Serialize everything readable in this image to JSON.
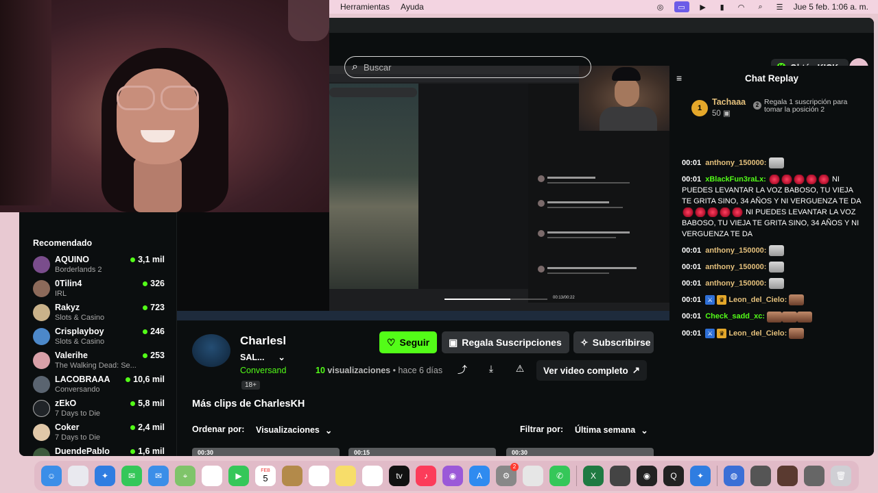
{
  "menubar": {
    "items": [
      "Herramientas",
      "Ayuda"
    ],
    "clock": "Jue 5 feb.  1:06 a. m."
  },
  "header": {
    "search_placeholder": "Buscar",
    "get_kicks": "Obtén KICKs"
  },
  "sidebar": {
    "title": "Recomendado",
    "channels": [
      {
        "name": "AQUINO",
        "category": "Borderlands 2",
        "viewers": "3,1 mil",
        "color": "#7a4d8c"
      },
      {
        "name": "0Tilin4",
        "category": "IRL",
        "viewers": "326",
        "color": "#8c6a5a"
      },
      {
        "name": "Rakyz",
        "category": "Slots & Casino",
        "viewers": "723",
        "color": "#c9b28a"
      },
      {
        "name": "Crisplayboy",
        "category": "Slots & Casino",
        "viewers": "246",
        "color": "#4c88c9"
      },
      {
        "name": "Valerihe",
        "category": "The Walking Dead: Se...",
        "viewers": "253",
        "color": "#d8a0a8"
      },
      {
        "name": "LACOBRAAA",
        "category": "Conversando",
        "viewers": "10,6 mil",
        "color": "#5a6470"
      },
      {
        "name": "zEkO",
        "category": "7 Days to Die",
        "viewers": "5,8 mil",
        "color": "#202428"
      },
      {
        "name": "Coker",
        "category": "7 Days to Die",
        "viewers": "2,4 mil",
        "color": "#e0c8a8"
      },
      {
        "name": "DuendePablo",
        "category": "",
        "viewers": "1,6 mil",
        "color": "#3c5a3c"
      }
    ]
  },
  "clip": {
    "channel": "Charlesl",
    "title": "SAL...",
    "category": "Conversand",
    "badge": "18+",
    "views_number": "10",
    "views_label": "visualizaciones",
    "age": "hace 6 días",
    "follow": "Seguir",
    "gift_subs": "Regala Suscripciones",
    "subscribe": "Subscribirse",
    "full_video": "Ver video completo",
    "video_time": "00:13/00:22"
  },
  "more_clips": {
    "title": "Más clips de CharlesKH",
    "sort_label": "Ordenar por:",
    "sort_value": "Visualizaciones",
    "filter_label": "Filtrar por:",
    "filter_value": "Última semana",
    "thumbs": [
      "00:30",
      "00:15",
      "00:30"
    ]
  },
  "chat": {
    "title": "Chat Replay",
    "top_gifter": {
      "rank": "1",
      "user": "Tachaaa",
      "count": "50",
      "promo_rank": "2",
      "promo": "Regala 1 suscripción para tomar la posición 2"
    },
    "messages": [
      {
        "time": "00:01",
        "user": "anthony_150000:",
        "color": "#e4c07c",
        "text": "",
        "emotes": [
          "cat"
        ]
      },
      {
        "time": "00:01",
        "user": "xBlackFun3raLx:",
        "color": "#53fc18",
        "text": "NI PUEDES LEVANTAR LA VOZ BABOSO, TU VIEJA TE GRITA SINO, 34 AÑOS Y NI VERGUENZA TE DA",
        "text2": "NI PUEDES LEVANTAR LA VOZ BABOSO, TU VIEJA TE GRITA SINO, 34 AÑOS Y NI VERGUENZA TE DA",
        "emotes": [
          "red",
          "red",
          "red",
          "red",
          "red"
        ]
      },
      {
        "time": "00:01",
        "user": "anthony_150000:",
        "color": "#e4c07c",
        "text": "",
        "emotes": [
          "cat"
        ]
      },
      {
        "time": "00:01",
        "user": "anthony_150000:",
        "color": "#e4c07c",
        "text": "",
        "emotes": [
          "cat"
        ]
      },
      {
        "time": "00:01",
        "user": "anthony_150000:",
        "color": "#e4c07c",
        "text": "",
        "emotes": [
          "cat"
        ]
      },
      {
        "time": "00:01",
        "user": "Leon_del_Cielo:",
        "color": "#e4c07c",
        "text": "",
        "emotes": [
          "face"
        ],
        "badges": true
      },
      {
        "time": "00:01",
        "user": "Check_sadd_xc:",
        "color": "#53fc18",
        "text": "",
        "emotes": [
          "face",
          "face",
          "face"
        ]
      },
      {
        "time": "00:01",
        "user": "Leon_del_Cielo:",
        "color": "#e4c07c",
        "text": "",
        "emotes": [
          "face"
        ],
        "badges": true
      }
    ]
  },
  "dock": {
    "calendar_month": "FEB",
    "calendar_day": "5",
    "settings_badge": "2"
  }
}
